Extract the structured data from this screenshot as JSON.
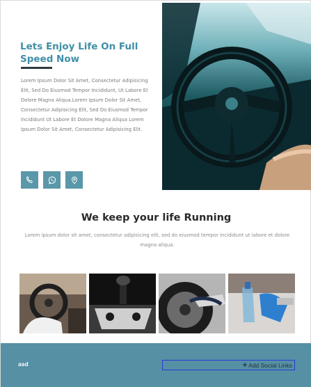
{
  "hero": {
    "title": "Lets Enjoy Life On Full Speed Now",
    "body": "Lorem Ipsum Dolor Sit Amet, Consectetur Adipisicing Elit, Sed Do Eiusmod Tempor Incididunt, Ut Labore Et Dolore Magna Aliqua.Lorem Ipsum Dolor Sit Amet, Consectetur Adipisicing Elit, Sed Do Eiusmod Tempor Incididunt Ut Labore Et Dolore Magna Aliqua Lorem Ipsum Dolor Sit Amet, Consectetur Adipisicing Elit.",
    "social_icons": [
      "phone-icon",
      "whatsapp-icon",
      "location-pin-icon"
    ]
  },
  "section": {
    "title": "We keep your life Running",
    "text": "Lorem ipsum dolor sit amet, consectetur adipisicing elit, sed do eiusmod tempor incididunt ut labore et dolore magna aliqua."
  },
  "gallery": [
    "car-interior-photo",
    "gear-shift-photo",
    "tire-cleaning-photo",
    "car-door-cleaning-photo"
  ],
  "footer": {
    "brand": "asd",
    "add_social_label": "Add Social Links"
  },
  "colors": {
    "accent": "#3f8fa7",
    "button": "#5a97a9",
    "footer_bg": "#5590a4",
    "selection_outline": "#2d3ad6"
  }
}
